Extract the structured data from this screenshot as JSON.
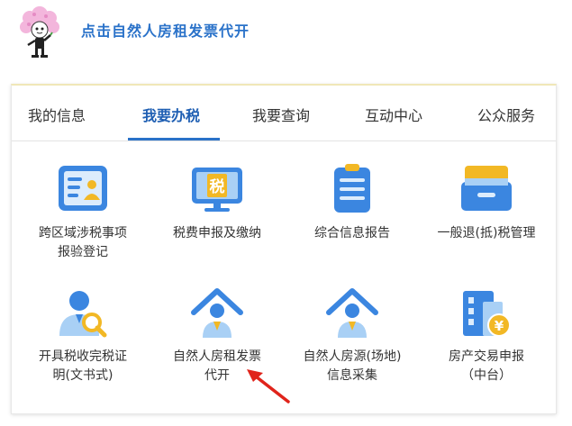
{
  "header": {
    "title": "点击自然人房租发票代开"
  },
  "tabs": [
    {
      "label": "我的信息",
      "active": false
    },
    {
      "label": "我要办税",
      "active": true
    },
    {
      "label": "我要查询",
      "active": false
    },
    {
      "label": "互动中心",
      "active": false
    },
    {
      "label": "公众服务",
      "active": false
    }
  ],
  "services": [
    {
      "line1": "跨区域涉税事项",
      "line2": "报验登记",
      "icon": "id-card-icon"
    },
    {
      "line1": "税费申报及缴纳",
      "line2": "",
      "icon": "monitor-tax-icon",
      "icon_text": "税"
    },
    {
      "line1": "综合信息报告",
      "line2": "",
      "icon": "clipboard-icon"
    },
    {
      "line1": "一般退(抵)税管理",
      "line2": "",
      "icon": "drawer-icon"
    },
    {
      "line1": "开具税收完税证",
      "line2": "明(文书式)",
      "icon": "person-search-icon"
    },
    {
      "line1": "自然人房租发票",
      "line2": "代开",
      "icon": "house-person-icon"
    },
    {
      "line1": "自然人房源(场地)",
      "line2": "信息采集",
      "icon": "house-person-icon"
    },
    {
      "line1": "房产交易申报",
      "line2": "（中台）",
      "icon": "building-yuan-icon",
      "icon_text": "¥"
    }
  ],
  "colors": {
    "title": "#2a72c9",
    "active_tab": "#1f5fb3",
    "icon_blue": "#3b86e0",
    "icon_light": "#a9d0f5",
    "icon_yellow": "#f2b825",
    "arrow": "#e0241b"
  }
}
